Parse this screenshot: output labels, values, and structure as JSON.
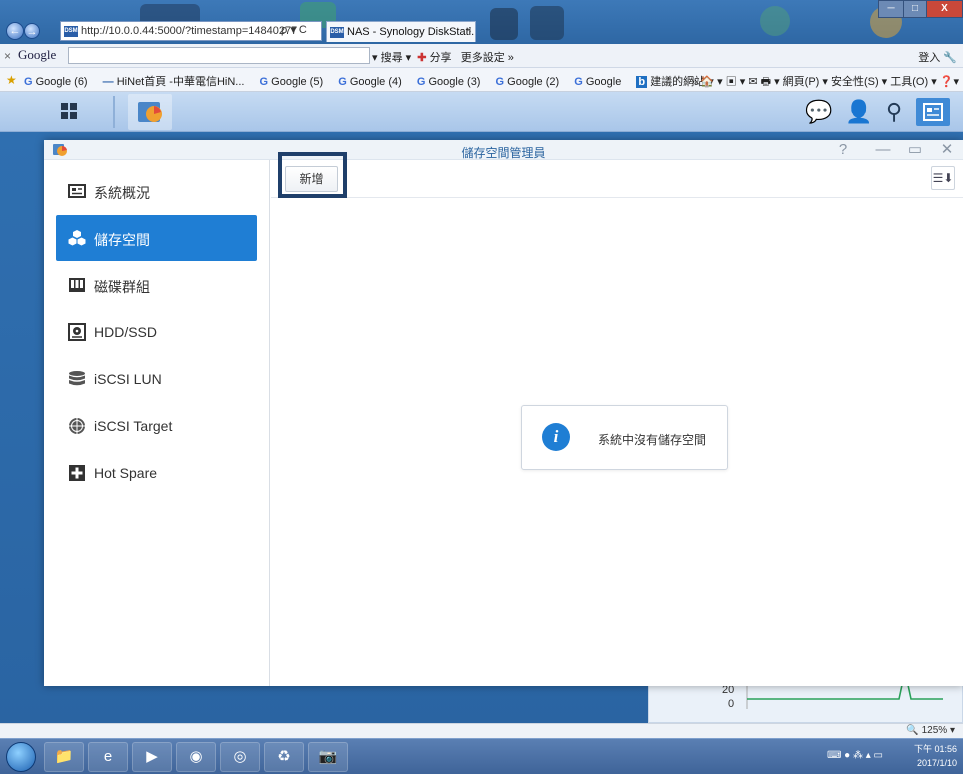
{
  "browser": {
    "url": "http://10.0.0.44:5000/?timestamp=14840277",
    "tab_title": "NAS - Synology DiskStati...",
    "tab_close": "×",
    "nav_back": "←",
    "nav_forward": "→",
    "addr_tools": "ρ ▾ C",
    "minimize": "─",
    "maximize": "□",
    "close": "X"
  },
  "google_toolbar": {
    "close": "×",
    "logo": "Google",
    "search_label": "▾ 搜尋 ▾",
    "share_label": "分享",
    "more_label": "更多設定 »",
    "login_label": "登入 🔧"
  },
  "favorites": {
    "items": [
      "Google (6)",
      "HiNet首頁 -中華電信HiN...",
      "Google (5)",
      "Google (4)",
      "Google (3)",
      "Google (2)",
      "Google",
      "建議的網站 ▾"
    ],
    "commands": "» 🏠 ▾ ▣ ▾ ✉ 🖶 ▾ 網頁(P) ▾ 安全性(S) ▾ 工具(O) ▾ ❓▾"
  },
  "window": {
    "title": "儲存空間管理員",
    "help": "?",
    "minimize": "—",
    "maximize": "▭",
    "close": "✕"
  },
  "sidebar": {
    "items": [
      {
        "label": "系統概況",
        "icon": "overview-icon"
      },
      {
        "label": "儲存空間",
        "icon": "storage-icon"
      },
      {
        "label": "磁碟群組",
        "icon": "disk-group-icon"
      },
      {
        "label": "HDD/SSD",
        "icon": "hdd-icon"
      },
      {
        "label": "iSCSI LUN",
        "icon": "lun-icon"
      },
      {
        "label": "iSCSI Target",
        "icon": "target-icon"
      },
      {
        "label": "Hot Spare",
        "icon": "hot-spare-icon"
      }
    ],
    "active_index": 1
  },
  "toolbar": {
    "add_label": "新增",
    "sort_label": "☰⬇"
  },
  "main": {
    "empty_message": "系統中沒有儲存空間",
    "info_glyph": "i"
  },
  "widget": {
    "tick_20": "20",
    "tick_0": "0"
  },
  "status": {
    "zoom": "🔍 125% ▾"
  },
  "taskbar": {
    "clock_time": "下午 01:56",
    "clock_date": "2017/1/10"
  },
  "colors": {
    "accent": "#1f7ed4",
    "highlight_frame": "#1f3f6a",
    "desktop": "#2f6fb0"
  }
}
